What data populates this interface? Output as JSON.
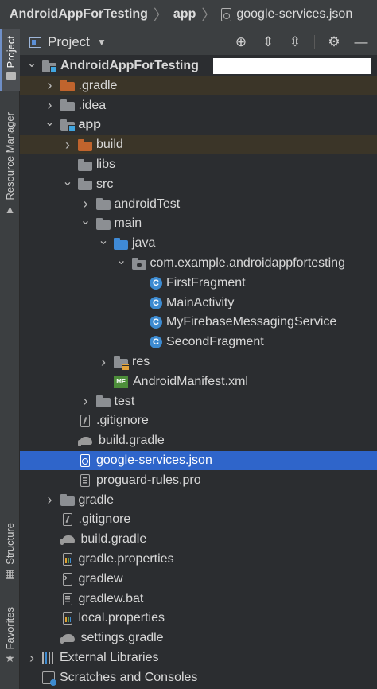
{
  "breadcrumb": {
    "items": [
      "AndroidAppForTesting",
      "app",
      "google-services.json"
    ]
  },
  "left_strip": {
    "tabs": [
      "Project",
      "Resource Manager",
      "Structure",
      "Favorites"
    ]
  },
  "header": {
    "title": "Project",
    "icons": [
      "locate-icon",
      "expand-all-icon",
      "collapse-all-icon",
      "settings-icon",
      "hide-icon"
    ]
  },
  "tree": {
    "rows": [
      {
        "label": "AndroidAppForTesting",
        "depth": 0,
        "expanded": true,
        "icon": "module-folder",
        "bold": true
      },
      {
        "label": ".gradle",
        "depth": 1,
        "expanded": false,
        "icon": "excluded-folder",
        "excluded": true
      },
      {
        "label": ".idea",
        "depth": 1,
        "expanded": false,
        "icon": "folder"
      },
      {
        "label": "app",
        "depth": 1,
        "expanded": true,
        "icon": "module-folder",
        "bold": true
      },
      {
        "label": "build",
        "depth": 2,
        "expanded": false,
        "icon": "excluded-folder",
        "excluded": true
      },
      {
        "label": "libs",
        "depth": 2,
        "expanded": null,
        "icon": "folder"
      },
      {
        "label": "src",
        "depth": 2,
        "expanded": true,
        "icon": "folder"
      },
      {
        "label": "androidTest",
        "depth": 3,
        "expanded": false,
        "icon": "folder"
      },
      {
        "label": "main",
        "depth": 3,
        "expanded": true,
        "icon": "folder"
      },
      {
        "label": "java",
        "depth": 4,
        "expanded": true,
        "icon": "source-folder"
      },
      {
        "label": "com.example.androidappfortesting",
        "depth": 5,
        "expanded": true,
        "icon": "package-folder"
      },
      {
        "label": "FirstFragment",
        "depth": 6,
        "expanded": null,
        "icon": "class"
      },
      {
        "label": "MainActivity",
        "depth": 6,
        "expanded": null,
        "icon": "class"
      },
      {
        "label": "MyFirebaseMessagingService",
        "depth": 6,
        "expanded": null,
        "icon": "class"
      },
      {
        "label": "SecondFragment",
        "depth": 6,
        "expanded": null,
        "icon": "class"
      },
      {
        "label": "res",
        "depth": 4,
        "expanded": false,
        "icon": "res-folder"
      },
      {
        "label": "AndroidManifest.xml",
        "depth": 4,
        "expanded": null,
        "icon": "manifest"
      },
      {
        "label": "test",
        "depth": 3,
        "expanded": false,
        "icon": "folder"
      },
      {
        "label": ".gitignore",
        "depth": 2,
        "expanded": null,
        "icon": "gitignore-file"
      },
      {
        "label": "build.gradle",
        "depth": 2,
        "expanded": null,
        "icon": "gradle"
      },
      {
        "label": "google-services.json",
        "depth": 2,
        "expanded": null,
        "icon": "json-file",
        "selected": true
      },
      {
        "label": "proguard-rules.pro",
        "depth": 2,
        "expanded": null,
        "icon": "text-file"
      },
      {
        "label": "gradle",
        "depth": 1,
        "expanded": false,
        "icon": "folder"
      },
      {
        "label": ".gitignore",
        "depth": 1,
        "expanded": null,
        "icon": "gitignore-file"
      },
      {
        "label": "build.gradle",
        "depth": 1,
        "expanded": null,
        "icon": "gradle"
      },
      {
        "label": "gradle.properties",
        "depth": 1,
        "expanded": null,
        "icon": "properties-file"
      },
      {
        "label": "gradlew",
        "depth": 1,
        "expanded": null,
        "icon": "terminal-file"
      },
      {
        "label": "gradlew.bat",
        "depth": 1,
        "expanded": null,
        "icon": "text-file"
      },
      {
        "label": "local.properties",
        "depth": 1,
        "expanded": null,
        "icon": "properties-file"
      },
      {
        "label": "settings.gradle",
        "depth": 1,
        "expanded": null,
        "icon": "gradle"
      },
      {
        "label": "External Libraries",
        "depth": 0,
        "expanded": false,
        "icon": "libraries"
      },
      {
        "label": "Scratches and Consoles",
        "depth": 0,
        "expanded": null,
        "icon": "scratches"
      }
    ]
  },
  "colors": {
    "selection": "#2f65ca",
    "excluded_folder": "#c0642d",
    "source_folder": "#3f8ad6",
    "class_icon": "#3d8bd1"
  }
}
